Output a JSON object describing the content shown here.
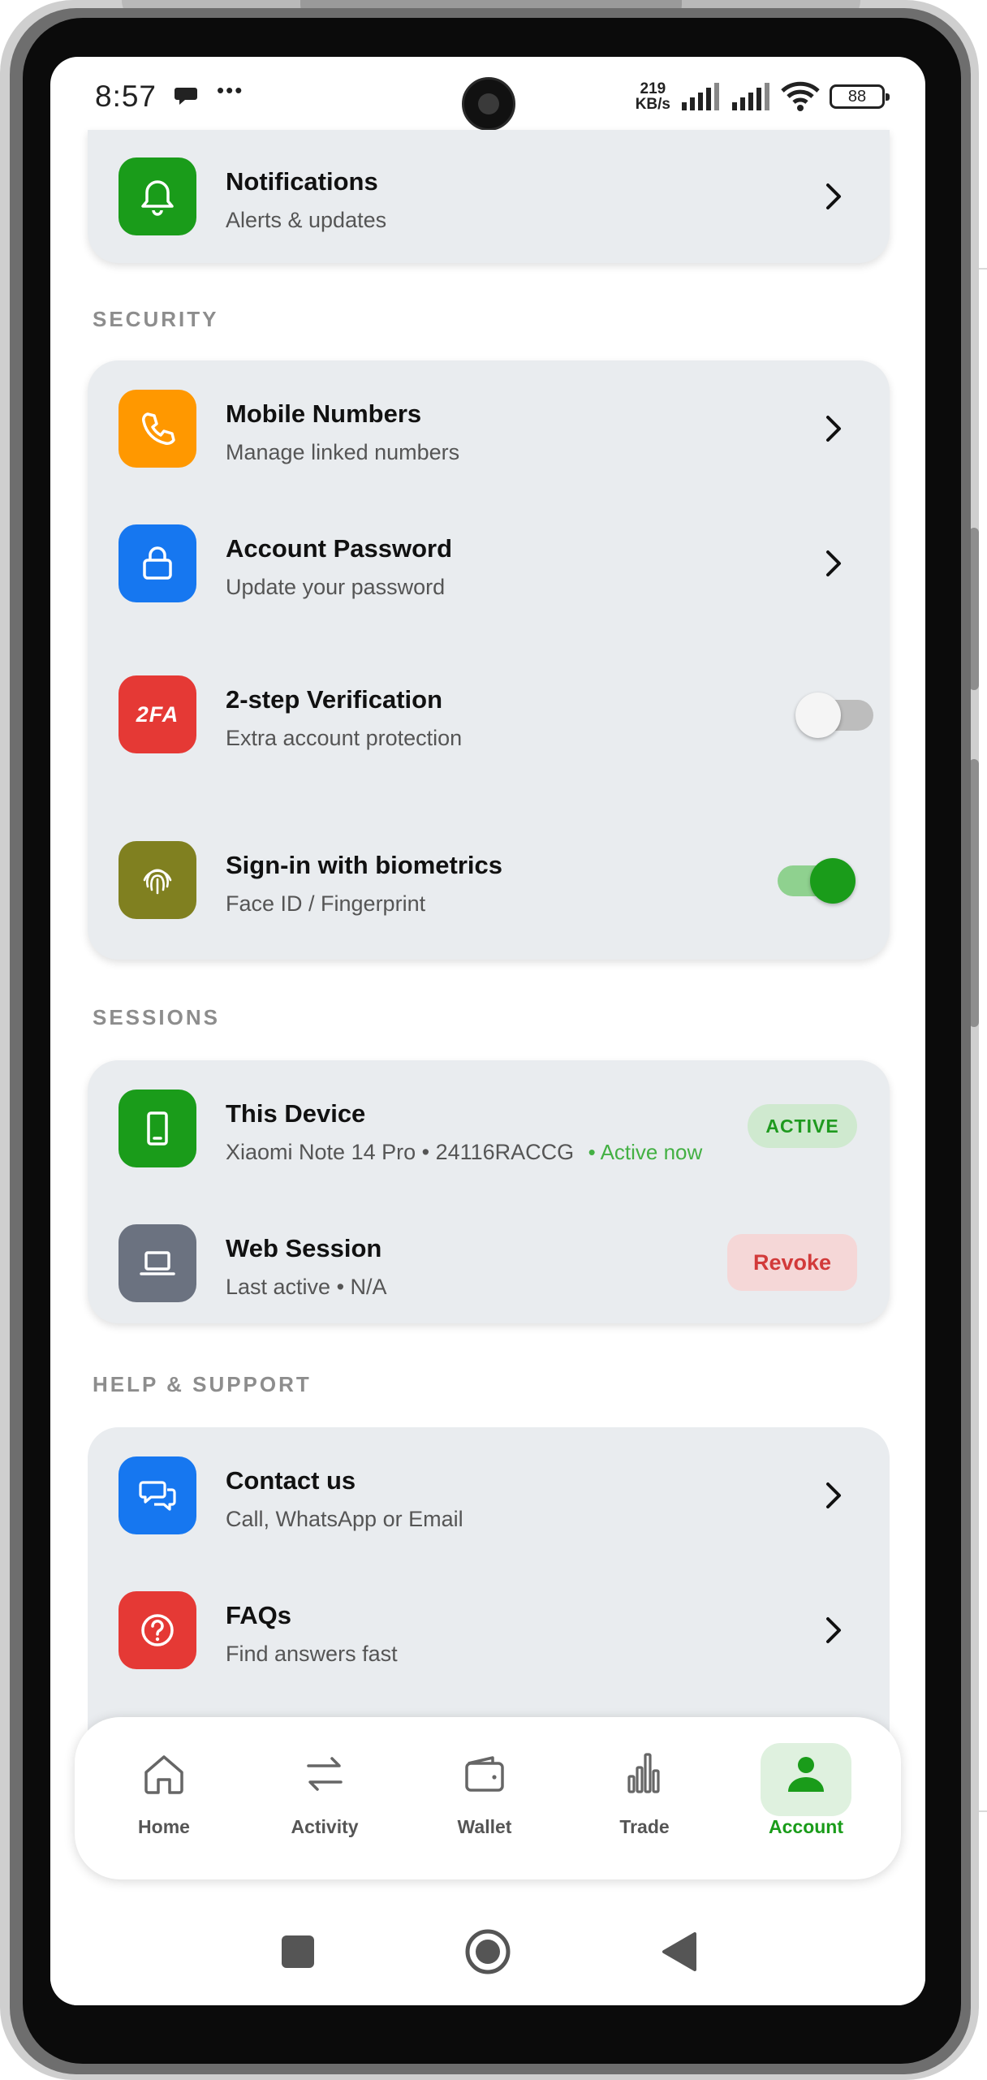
{
  "status_bar": {
    "time": "8:57",
    "chat_icon": "chat-bubble-icon",
    "more": "•••",
    "net_speed_value": "219",
    "net_speed_unit": "KB/s",
    "battery": "88"
  },
  "notifications_row": {
    "title": "Notifications",
    "subtitle": "Alerts & updates",
    "icon": "bell-icon",
    "icon_color": "#1a9c1a"
  },
  "security": {
    "label": "SECURITY",
    "items": [
      {
        "title": "Mobile Numbers",
        "subtitle": "Manage linked numbers",
        "icon": "phone-icon",
        "icon_color": "#ff9800"
      },
      {
        "title": "Account Password",
        "subtitle": "Update your password",
        "icon": "lock-icon",
        "icon_color": "#1677f0"
      },
      {
        "title": "2-step Verification",
        "subtitle": "Extra account protection",
        "icon": "2fa-icon",
        "icon_text": "2FA",
        "icon_color": "#e53935",
        "toggle": false
      },
      {
        "title": "Sign-in with biometrics",
        "subtitle": "Face ID / Fingerprint",
        "icon": "fingerprint-icon",
        "icon_color": "#808020",
        "toggle": true
      }
    ]
  },
  "sessions": {
    "label": "SESSIONS",
    "items": [
      {
        "title": "This Device",
        "subtitle": "Xiaomi Note 14 Pro • 24116RACCG",
        "status_text": "• Active now",
        "badge": "ACTIVE",
        "icon": "smartphone-icon",
        "icon_color": "#1a9c1a"
      },
      {
        "title": "Web Session",
        "subtitle": "Last active • N/A",
        "action": "Revoke",
        "icon": "laptop-icon",
        "icon_color": "#6b7280"
      }
    ]
  },
  "help": {
    "label": "HELP & SUPPORT",
    "items": [
      {
        "title": "Contact us",
        "subtitle": "Call, WhatsApp or Email",
        "icon": "chat-icon",
        "icon_color": "#1677f0"
      },
      {
        "title": "FAQs",
        "subtitle": "Find answers fast",
        "icon": "help-circle-icon",
        "icon_color": "#e53935"
      }
    ]
  },
  "bottom_nav": {
    "items": [
      {
        "label": "Home",
        "icon": "home-icon"
      },
      {
        "label": "Activity",
        "icon": "arrows-swap-icon"
      },
      {
        "label": "Wallet",
        "icon": "wallet-icon"
      },
      {
        "label": "Trade",
        "icon": "bar-chart-icon"
      },
      {
        "label": "Account",
        "icon": "user-icon",
        "active": true
      }
    ],
    "active_color": "#1a9c1a"
  },
  "system_nav": {
    "recents": "square-icon",
    "home": "circle-icon",
    "back": "triangle-back-icon"
  }
}
